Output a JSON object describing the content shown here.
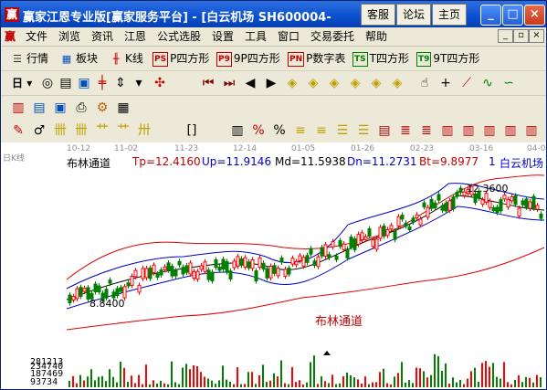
{
  "window": {
    "title": "赢家江恩专业版[赢家服务平台] - [白云机场    SH600004-",
    "app_icon_glyph": "赢",
    "top_buttons": [
      "客服",
      "论坛",
      "主页"
    ],
    "controls": {
      "minimize": "_",
      "maximize": "□",
      "close": "×"
    }
  },
  "menubar": {
    "doc_icon_glyph": "赢",
    "items": [
      "文件",
      "浏览",
      "资讯",
      "江恩",
      "公式选股",
      "设置",
      "工具",
      "窗口",
      "交易委托",
      "帮助"
    ],
    "mdi_controls": [
      "_",
      "▫",
      "×"
    ]
  },
  "toolbar1": {
    "items": [
      {
        "icon": "quote-icon",
        "label": "行情"
      },
      {
        "icon": "sector-icon",
        "label": "板块"
      },
      {
        "icon": "kline-icon",
        "label": "K线"
      },
      {
        "icon_text": "PS",
        "label": "P四方形"
      },
      {
        "icon_text": "P9",
        "label": "9P四方形"
      },
      {
        "icon_text": "PN",
        "label": "P数字表"
      },
      {
        "icon_text": "TS",
        "label": "T四方形"
      },
      {
        "icon_text": "T9",
        "label": "9T四方形"
      }
    ]
  },
  "toolbar2": {
    "period_label": "日",
    "icons": [
      "circle-icon",
      "page-icon",
      "square-icon",
      "candle-icon",
      "arrow-icon",
      "bar-icon",
      "diamond-icon",
      "first-icon",
      "last-icon",
      "left-icon",
      "right-icon",
      "diamond1-icon",
      "diamond2-icon",
      "diamond3-icon",
      "diamond4-icon",
      "diamond5-icon",
      "diamond6-icon",
      "diamond7-icon",
      "hand-icon",
      "crosshair-icon",
      "draw-line-icon",
      "wave-icon"
    ]
  },
  "toolbar3": {
    "icons": [
      "calendar-icon",
      "doc-icon",
      "window-icon",
      "print-icon",
      "settings-icon",
      "grid-icon"
    ]
  },
  "toolbar4": {
    "icons": [
      "pen-icon",
      "tool-2-icon",
      "fork-icon",
      "fork2-icon",
      "fork3-icon",
      "fork4-icon",
      "fork5-icon",
      "bracket-icon",
      "gann-icon",
      "percent-icon",
      "percent2-icon",
      "tool-b-icon",
      "tool-c-icon",
      "tool-d-icon",
      "tool-e-icon",
      "tool-f-icon",
      "tool-g-icon",
      "tool-h-icon",
      "tool-i-icon",
      "tool-j-icon"
    ]
  },
  "chart": {
    "left_label": "日K线",
    "dates": [
      "10-12",
      "11-02",
      "11-23",
      "12-14",
      "01-05",
      "01-26",
      "02-23",
      "03-16",
      "04-0"
    ],
    "indicator_name": "布林通道",
    "tp": "Tp=12.4160",
    "up": "Up=11.9146",
    "md": "Md=11.5938",
    "dn": "Dn=11.2731",
    "bt": "Bt=9.8977",
    "stock_index": "1",
    "stock_name": "白云机场",
    "high_label": "12.3600",
    "low_label": "8.8400",
    "band_label": "布林通道",
    "volume_labels": [
      "281213",
      "234740",
      "187469",
      "93734"
    ],
    "colors": {
      "up": "#ff0000",
      "down": "#008000",
      "band": "#0000c0",
      "outer": "#e00000",
      "mid": "#000000"
    }
  }
}
